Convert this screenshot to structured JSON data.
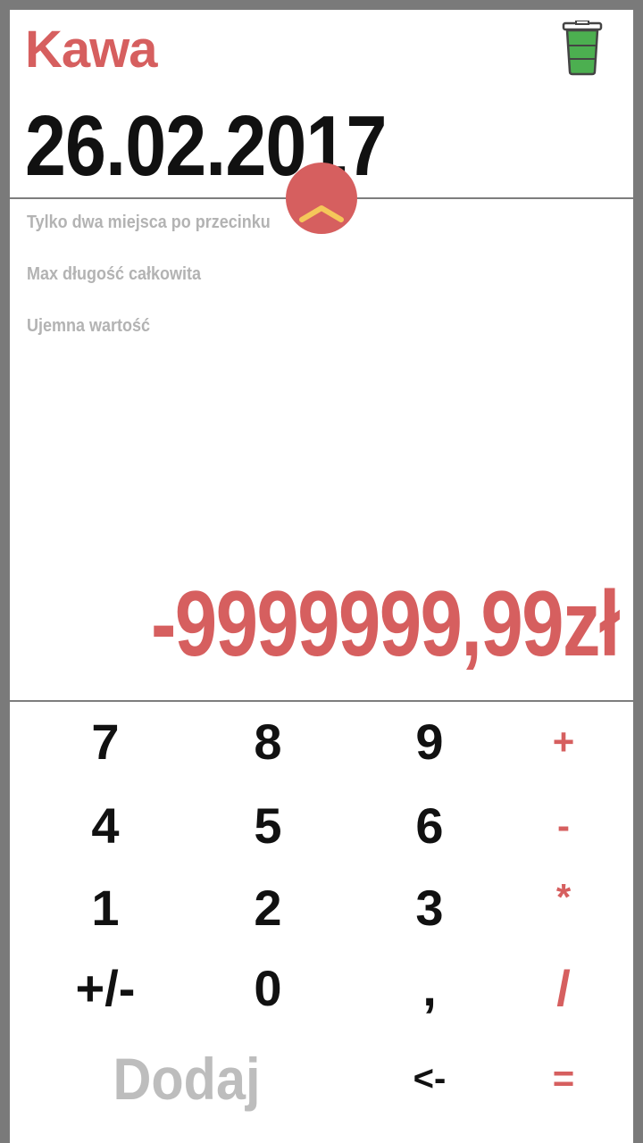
{
  "header": {
    "category": "Kawa",
    "date": "26.02.2017"
  },
  "icons": {
    "delete": "trash-icon",
    "toggle": "chevron-up-icon"
  },
  "colors": {
    "accent": "#d65f5f",
    "trash_fill": "#4caf50",
    "chevron": "#f5c75a",
    "muted_text": "#b3b3b3"
  },
  "options": [
    "Tylko dwa miejsca po przecinku",
    "Max długość całkowita",
    "Ujemna wartość"
  ],
  "amount": "-9999999,99zł",
  "keypad": {
    "k7": "7",
    "k8": "8",
    "k9": "9",
    "plus": "+",
    "k4": "4",
    "k5": "5",
    "k6": "6",
    "minus": "-",
    "k1": "1",
    "k2": "2",
    "k3": "3",
    "multiply": "*",
    "sign": "+/-",
    "k0": "0",
    "comma": ",",
    "divide": "/",
    "add": "Dodaj",
    "backspace": "<-",
    "equals": "="
  }
}
